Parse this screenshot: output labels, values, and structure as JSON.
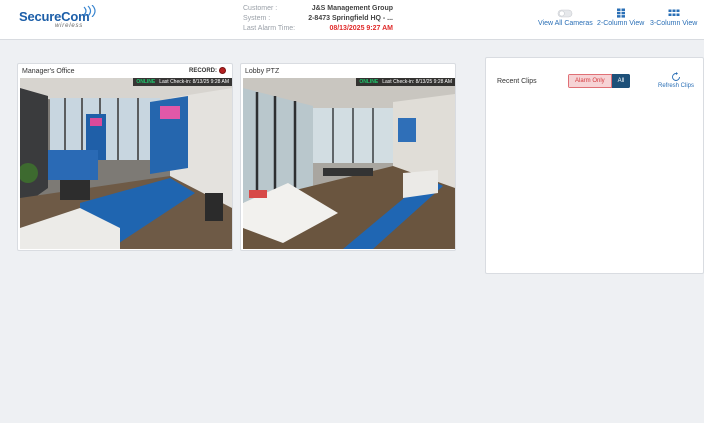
{
  "brand": {
    "name_part1": "Secure",
    "name_part2": "Com",
    "tagline": "wireless"
  },
  "system_info": {
    "customer_label": "Customer :",
    "customer_value": "J&S Management Group",
    "system_label": "System :",
    "system_value": "2-8473 Springfield HQ - ...",
    "alarm_label": "Last Alarm Time:",
    "alarm_value": "08/13/2025 9:27 AM"
  },
  "view_controls": {
    "all_cameras": "View All Cameras",
    "two_column": "2-Column View",
    "three_column": "3-Column View"
  },
  "cameras": [
    {
      "title": "Manager's Office",
      "record_label": "RECORD:",
      "status": "ONLINE",
      "checkin": "Last Check-in: 8/13/25 9:28 AM"
    },
    {
      "title": "Lobby PTZ",
      "status": "ONLINE",
      "checkin": "Last Check-in: 8/13/25 9:28 AM"
    }
  ],
  "clips": {
    "title": "Recent Clips",
    "filter_alarm": "Alarm Only",
    "filter_all": "All",
    "refresh_label": "Refresh Clips"
  },
  "colors": {
    "brand_blue": "#1c5ea8",
    "alarm_red": "#e02a2a",
    "online_green": "#1ec46b",
    "link_blue": "#2a6fb6"
  }
}
